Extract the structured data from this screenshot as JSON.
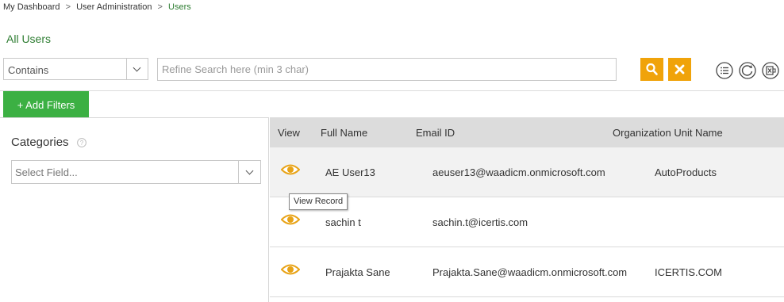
{
  "breadcrumb": {
    "items": [
      "My Dashboard",
      "User Administration",
      "Users"
    ],
    "separator": ">"
  },
  "page_title": "All Users",
  "search": {
    "match_type": "Contains",
    "placeholder": "Refine Search here (min 3 char)",
    "value": ""
  },
  "icons": {
    "search": "search-icon",
    "clear": "close-icon",
    "list": "list-icon",
    "refresh": "refresh-icon",
    "export": "excel-export-icon",
    "view": "eye-icon",
    "help": "question-icon"
  },
  "filters": {
    "add_label": "+ Add Filters"
  },
  "categories": {
    "title": "Categories",
    "select_placeholder": "Select Field..."
  },
  "grid": {
    "columns": [
      "View",
      "Full Name",
      "Email ID",
      "Organization Unit Name"
    ],
    "rows": [
      {
        "full_name": "AE User13",
        "email": "aeuser13@waadicm.onmicrosoft.com",
        "org_unit": "AutoProducts"
      },
      {
        "full_name": "sachin t",
        "email": "sachin.t@icertis.com",
        "org_unit": ""
      },
      {
        "full_name": "Prajakta Sane",
        "email": "Prajakta.Sane@waadicm.onmicrosoft.com",
        "org_unit": "ICERTIS.COM"
      }
    ]
  },
  "tooltip": {
    "text": "View Record"
  },
  "colors": {
    "accent_green": "#2e7d32",
    "button_green": "#3cb043",
    "button_orange": "#f0a30a",
    "eye_orange": "#e8a317",
    "header_gray": "#dcdcdc"
  }
}
